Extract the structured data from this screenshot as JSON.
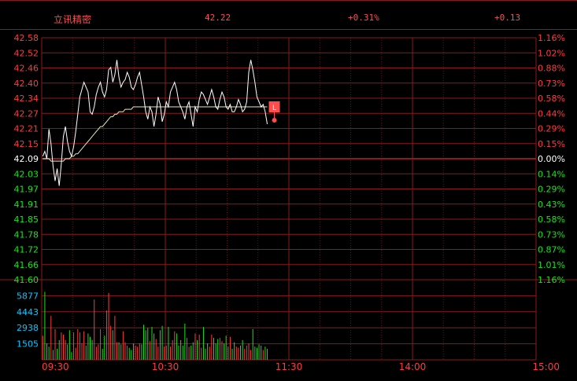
{
  "header": {
    "stock_name": "立讯精密",
    "price": "42.22",
    "change_pct": "+0.31%",
    "change": "+0.13"
  },
  "colors": {
    "up": "#ff3b3b",
    "down": "#18e418",
    "grid": "#8b1a1a",
    "price_line": "#ffffff",
    "avg_line": "#e8e8b8",
    "base_label": "#ffffff",
    "volume_label": "#00c8ff",
    "marker": "#ff4d4d"
  },
  "chart_data": {
    "type": "line",
    "price_ticks": [
      "42.58",
      "42.52",
      "42.46",
      "42.40",
      "42.34",
      "42.27",
      "42.21",
      "42.15",
      "42.09",
      "42.03",
      "41.97",
      "41.91",
      "41.85",
      "41.78",
      "41.72",
      "41.66",
      "41.60"
    ],
    "pct_ticks": [
      "1.16%",
      "1.02%",
      "0.88%",
      "0.73%",
      "0.58%",
      "0.44%",
      "0.29%",
      "0.15%",
      "0.00%",
      "0.14%",
      "0.29%",
      "0.43%",
      "0.58%",
      "0.73%",
      "0.87%",
      "1.01%",
      "1.16%"
    ],
    "base_price": 42.09,
    "ylim": [
      41.6,
      42.58
    ],
    "volume_ticks": [
      "5877",
      "4443",
      "2938",
      "1505"
    ],
    "volume_ylim": [
      0,
      7310
    ],
    "time_labels": [
      "09:30",
      "10:30",
      "11:30",
      "14:00",
      "15:00"
    ],
    "total_minutes": 240,
    "marker_label": "L",
    "price": [
      42.1,
      42.12,
      42.09,
      42.21,
      42.15,
      42.06,
      42.0,
      42.05,
      41.98,
      42.07,
      42.18,
      42.22,
      42.16,
      42.12,
      42.1,
      42.14,
      42.2,
      42.27,
      42.34,
      42.37,
      42.4,
      42.38,
      42.36,
      42.28,
      42.27,
      42.3,
      42.35,
      42.38,
      42.4,
      42.36,
      42.34,
      42.37,
      42.45,
      42.46,
      42.4,
      42.43,
      42.49,
      42.42,
      42.38,
      42.4,
      42.41,
      42.44,
      42.42,
      42.38,
      42.37,
      42.39,
      42.42,
      42.44,
      42.39,
      42.34,
      42.28,
      42.25,
      42.3,
      42.28,
      42.22,
      42.27,
      42.34,
      42.31,
      42.24,
      42.27,
      42.32,
      42.3,
      42.36,
      42.38,
      42.4,
      42.37,
      42.32,
      42.3,
      42.28,
      42.25,
      42.3,
      42.32,
      42.27,
      42.22,
      42.3,
      42.28,
      42.33,
      42.36,
      42.35,
      42.33,
      42.31,
      42.34,
      42.37,
      42.34,
      42.3,
      42.29,
      42.33,
      42.36,
      42.34,
      42.3,
      42.29,
      42.31,
      42.28,
      42.28,
      42.3,
      42.33,
      42.31,
      42.28,
      42.29,
      42.32,
      42.44,
      42.49,
      42.45,
      42.4,
      42.34,
      42.32,
      42.3,
      42.31,
      42.28,
      42.23
    ],
    "average": [
      42.09,
      42.09,
      42.09,
      42.09,
      42.08,
      42.08,
      42.08,
      42.08,
      42.08,
      42.08,
      42.08,
      42.09,
      42.09,
      42.09,
      42.1,
      42.1,
      42.11,
      42.11,
      42.12,
      42.13,
      42.14,
      42.15,
      42.16,
      42.17,
      42.18,
      42.19,
      42.2,
      42.21,
      42.22,
      42.22,
      42.23,
      42.24,
      42.25,
      42.26,
      42.26,
      42.27,
      42.27,
      42.28,
      42.28,
      42.28,
      42.29,
      42.29,
      42.29,
      42.29,
      42.3,
      42.3,
      42.3,
      42.3,
      42.3,
      42.3,
      42.3,
      42.3,
      42.3,
      42.3,
      42.3,
      42.3,
      42.3,
      42.3,
      42.3,
      42.3,
      42.3,
      42.3,
      42.3,
      42.3,
      42.3,
      42.3,
      42.3,
      42.3,
      42.3,
      42.3,
      42.3,
      42.3,
      42.3,
      42.3,
      42.3,
      42.3,
      42.3,
      42.3,
      42.3,
      42.3,
      42.3,
      42.3,
      42.3,
      42.3,
      42.3,
      42.3,
      42.3,
      42.3,
      42.3,
      42.3,
      42.3,
      42.3,
      42.3,
      42.3,
      42.3,
      42.3,
      42.3,
      42.3,
      42.3,
      42.3,
      42.3,
      42.3,
      42.3,
      42.3,
      42.3,
      42.3,
      42.3,
      42.3,
      42.3,
      42.3
    ],
    "volume": [
      2200,
      6200,
      1500,
      1200,
      4000,
      900,
      2800,
      1000,
      1800,
      2500,
      2300,
      1800,
      1400,
      2700,
      700,
      2500,
      1100,
      2800,
      2500,
      1500,
      2600,
      1300,
      2400,
      2100,
      1800,
      5500,
      1200,
      1400,
      2800,
      1000,
      2200,
      4500,
      6100,
      3100,
      2700,
      4000,
      1600,
      1600,
      1400,
      2600,
      1600,
      1300,
      1100,
      900,
      1500,
      1300,
      1200,
      1500,
      1400,
      3200,
      2700,
      2900,
      1700,
      3000,
      2400,
      1900,
      1200,
      2700,
      3100,
      1200,
      1300,
      3000,
      1200,
      1800,
      2600,
      2400,
      1300,
      1800,
      1300,
      3300,
      2000,
      1200,
      1300,
      1600,
      2400,
      1800,
      2300,
      1100,
      3000,
      1000,
      1500,
      1200,
      2300,
      2000,
      1500,
      1900,
      2000,
      1700,
      1500,
      2200,
      1200,
      2100,
      1000,
      1600,
      1200,
      1100,
      1300,
      1800,
      1000,
      1300,
      1500,
      900,
      2800,
      1200,
      1100,
      1400,
      1300,
      900,
      1200,
      1000
    ],
    "volume_up": [
      1,
      0,
      0,
      0,
      1,
      0,
      1,
      0,
      0,
      1,
      1,
      1,
      0,
      0,
      0,
      1,
      1,
      1,
      1,
      1,
      1,
      0,
      0,
      0,
      0,
      1,
      1,
      1,
      1,
      0,
      0,
      1,
      1,
      1,
      0,
      1,
      1,
      0,
      0,
      1,
      1,
      1,
      0,
      0,
      0,
      1,
      1,
      1,
      0,
      0,
      0,
      0,
      1,
      0,
      0,
      1,
      1,
      0,
      0,
      1,
      1,
      0,
      1,
      1,
      1,
      0,
      0,
      0,
      0,
      0,
      1,
      1,
      0,
      0,
      1,
      0,
      1,
      1,
      0,
      0,
      0,
      1,
      1,
      0,
      0,
      0,
      1,
      1,
      0,
      0,
      0,
      1,
      0,
      0,
      1,
      1,
      0,
      0,
      1,
      1,
      1,
      1,
      0,
      0,
      0,
      0,
      0,
      1,
      0,
      0
    ]
  }
}
